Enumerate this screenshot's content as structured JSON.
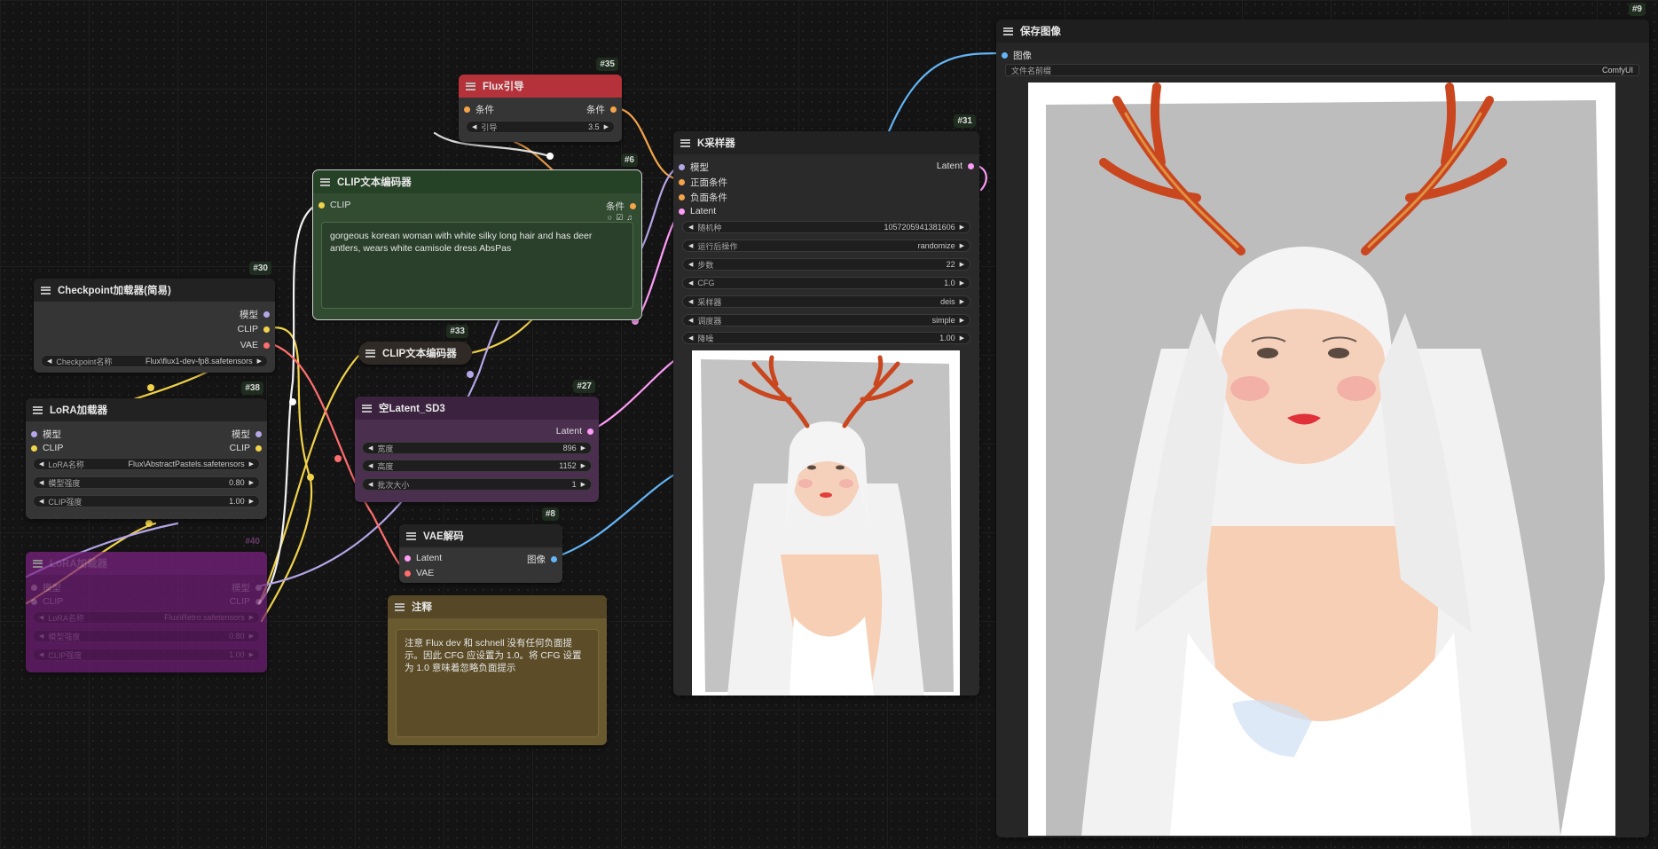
{
  "colors": {
    "canvas_bg": "#141414",
    "clip": "#f1d34a",
    "model": "#b5a6e8",
    "vae": "#ff6e6e",
    "conditioning": "#f5a44a",
    "latent": "#ff9cf9",
    "image": "#64b5f6"
  },
  "icons": {
    "node_menu": "hamburger-icon",
    "input_port": "socket-dot-icon",
    "widget_decrement": "left-triangle-icon",
    "widget_increment": "right-triangle-icon"
  },
  "nodes": {
    "flux_guidance": {
      "id": "#35",
      "title": "Flux引导",
      "title_color": "#b5323a",
      "in_label": "条件",
      "out_label": "条件",
      "widget": {
        "label": "引导",
        "value": "3.5"
      }
    },
    "clip_encoder_pos": {
      "id": "#6",
      "title": "CLIP文本编码器",
      "in_label": "CLIP",
      "out_label": "条件",
      "text": "gorgeous korean woman with white silky long hair and has deer antlers, wears white camisole dress AbsPas"
    },
    "checkpoint": {
      "id": "#30",
      "title": "Checkpoint加载器(简易)",
      "outputs": [
        "模型",
        "CLIP",
        "VAE"
      ],
      "widget": {
        "label": "Checkpoint名称",
        "value": "Flux\\flux1-dev-fp8.safetensors"
      }
    },
    "clip_encoder_neg": {
      "id": "#33",
      "title": "CLIP文本编码器"
    },
    "lora": {
      "id": "#38",
      "title": "LoRA加载器",
      "inputs": [
        "模型",
        "CLIP"
      ],
      "outputs": [
        "模型",
        "CLIP"
      ],
      "widgets": [
        {
          "label": "LoRA名称",
          "value": "Flux\\AbstractPastels.safetensors"
        },
        {
          "label": "模型强度",
          "value": "0.80"
        },
        {
          "label": "CLIP强度",
          "value": "1.00"
        }
      ]
    },
    "lora_bypassed": {
      "id": "#40",
      "title": "LoRA加载器",
      "inputs": [
        "模型",
        "CLIP"
      ],
      "outputs": [
        "模型",
        "CLIP"
      ],
      "widgets": [
        {
          "label": "LoRA名称",
          "value": "Flux\\Retro.safetensors"
        },
        {
          "label": "模型强度",
          "value": "0.80"
        },
        {
          "label": "CLIP强度",
          "value": "1.00"
        }
      ]
    },
    "empty_latent": {
      "id": "#27",
      "title": "空Latent_SD3",
      "out_label": "Latent",
      "widgets": [
        {
          "label": "宽度",
          "value": "896"
        },
        {
          "label": "高度",
          "value": "1152"
        },
        {
          "label": "批次大小",
          "value": "1"
        }
      ]
    },
    "vae_decode": {
      "id": "#8",
      "title": "VAE解码",
      "inputs": [
        "Latent",
        "VAE"
      ],
      "out_label": "图像"
    },
    "note": {
      "title": "注释",
      "text": "注意 Flux dev 和 schnell 没有任何负面提示。因此 CFG 应设置为 1.0。将 CFG 设置为 1.0 意味着忽略负面提示"
    },
    "ksampler": {
      "id": "#31",
      "title": "K采样器",
      "inputs": [
        "模型",
        "正面条件",
        "负面条件",
        "Latent"
      ],
      "out_label": "Latent",
      "widgets": [
        {
          "label": "随机种",
          "value": "1057205941381606"
        },
        {
          "label": "运行后操作",
          "value": "randomize"
        },
        {
          "label": "步数",
          "value": "22"
        },
        {
          "label": "CFG",
          "value": "1.0"
        },
        {
          "label": "采样器",
          "value": "deis"
        },
        {
          "label": "调度器",
          "value": "simple"
        },
        {
          "label": "降噪",
          "value": "1.00"
        }
      ]
    },
    "save_image": {
      "id": "#9",
      "title": "保存图像",
      "in_label": "图像",
      "widget": {
        "label": "文件名前缀",
        "value": "ComfyUI"
      }
    }
  }
}
